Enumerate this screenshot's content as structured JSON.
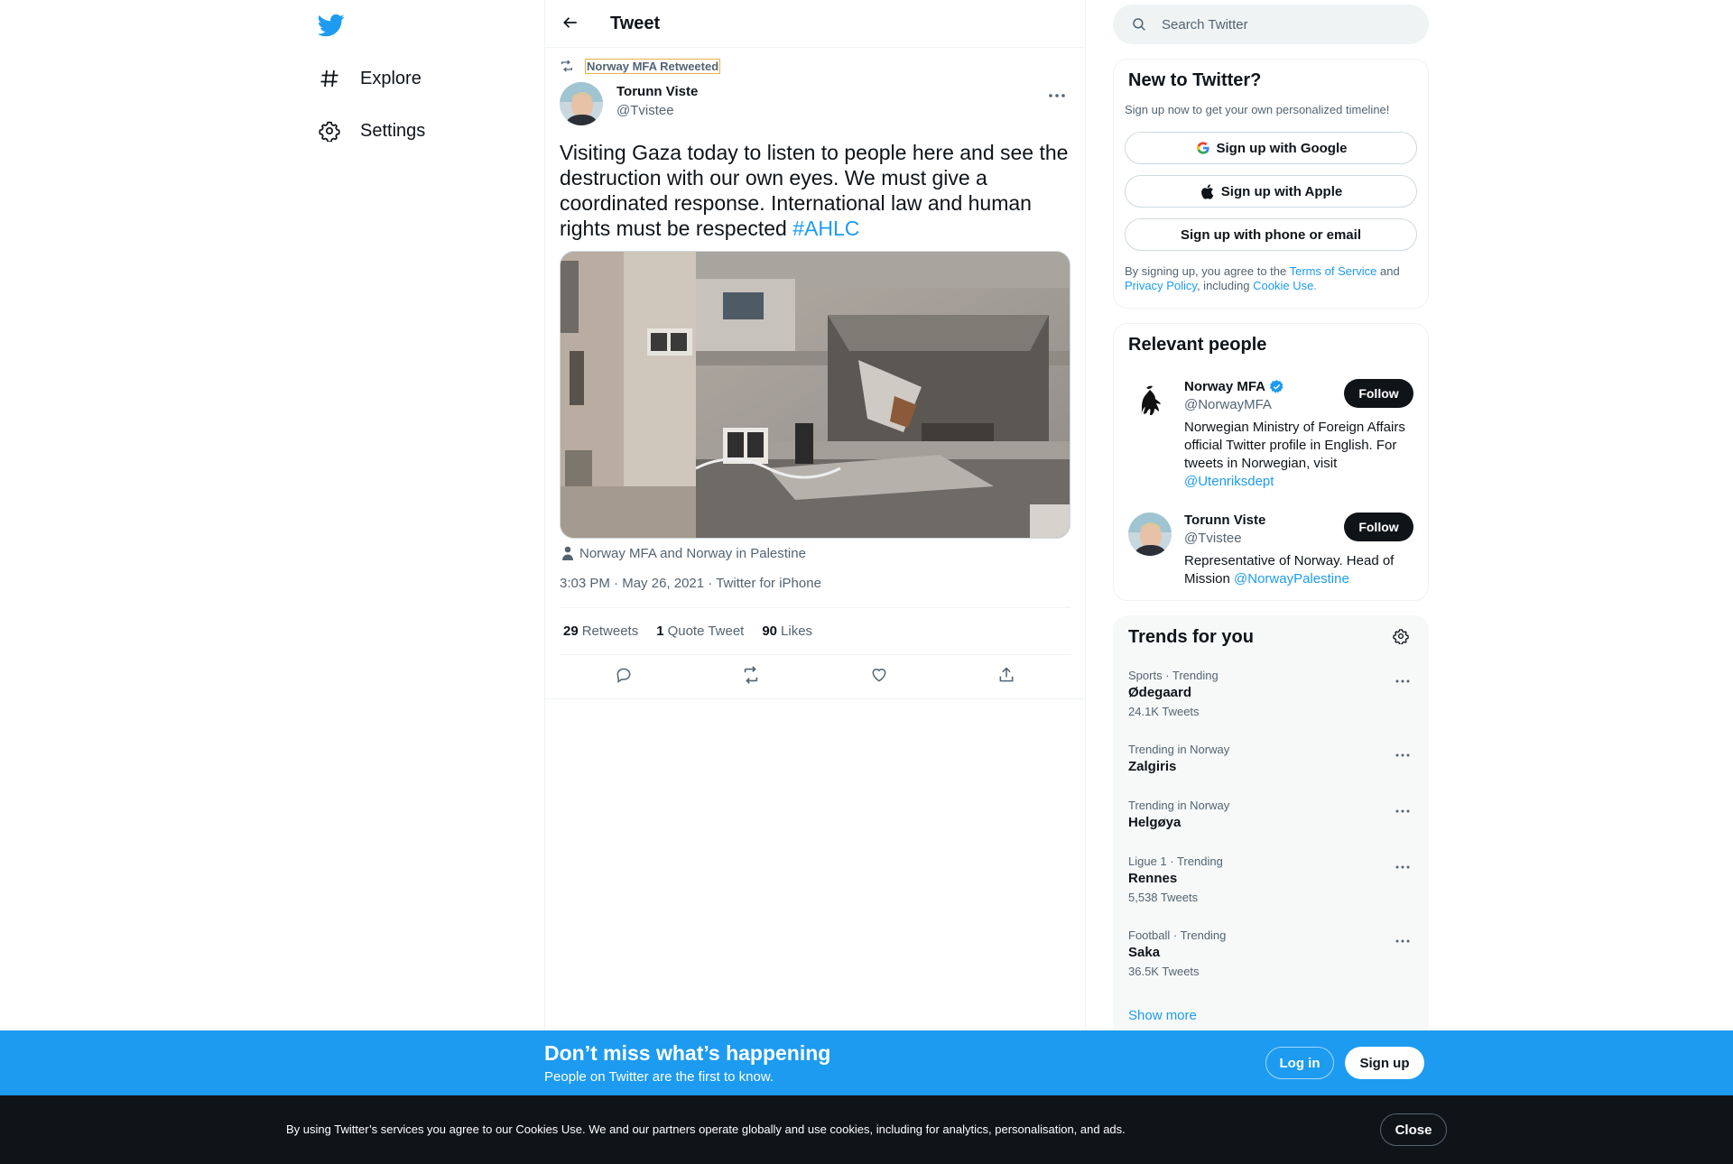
{
  "nav": {
    "logo_icon": "twitter-bird-icon",
    "items": [
      {
        "label": "Explore",
        "icon": "hashtag-icon"
      },
      {
        "label": "Settings",
        "icon": "gear-icon"
      }
    ]
  },
  "header": {
    "title": "Tweet",
    "back_icon": "arrow-left-icon"
  },
  "tweet": {
    "retweeted_by": "Norway MFA Retweeted",
    "author": {
      "name": "Torunn Viste",
      "handle": "@Tvistee"
    },
    "text": "Visiting Gaza today to listen to people here and see the destruction with our own eyes. We must give a coordinated response. International law and human rights must be respected ",
    "hashtag": "#AHLC",
    "tagged": "Norway MFA and Norway in Palestine",
    "time": "3:03 PM",
    "date": "May 26, 2021",
    "source": "Twitter for iPhone",
    "separator": " · ",
    "stats": {
      "retweets": {
        "count": "29",
        "label": "Retweets"
      },
      "quotes": {
        "count": "1",
        "label": "Quote Tweet"
      },
      "likes": {
        "count": "90",
        "label": "Likes"
      }
    }
  },
  "search": {
    "placeholder": "Search Twitter"
  },
  "new_to_twitter": {
    "title": "New to Twitter?",
    "subtitle": "Sign up now to get your own personalized timeline!",
    "buttons": {
      "google": "Sign up with Google",
      "apple": "Sign up with Apple",
      "phone": "Sign up with phone or email"
    },
    "legal": {
      "prefix": "By signing up, you agree to the ",
      "terms": "Terms of Service",
      "and": " and",
      "privacy": "Privacy Policy",
      "including": ", including ",
      "cookie": "Cookie Use."
    }
  },
  "relevant_people": {
    "title": "Relevant people",
    "people": [
      {
        "name": "Norway MFA",
        "handle": "@NorwayMFA",
        "bio": "Norwegian Ministry of Foreign Affairs official Twitter profile in English. For tweets in Norwegian, visit ",
        "bio_link": "@Utenriksdept",
        "follow": "Follow",
        "verified": true
      },
      {
        "name": "Torunn Viste",
        "handle": "@Tvistee",
        "bio": "Representative of Norway. Head of Mission ",
        "bio_link": "@NorwayPalestine",
        "follow": "Follow",
        "verified": false
      }
    ]
  },
  "trends": {
    "title": "Trends for you",
    "items": [
      {
        "context": "Sports · Trending",
        "name": "Ødegaard",
        "count": "24.1K Tweets"
      },
      {
        "context": "Trending in Norway",
        "name": "Zalgiris",
        "count": ""
      },
      {
        "context": "Trending in Norway",
        "name": "Helgøya",
        "count": ""
      },
      {
        "context": "Ligue 1 · Trending",
        "name": "Rennes",
        "count": "5,538 Tweets"
      },
      {
        "context": "Football · Trending",
        "name": "Saka",
        "count": "36.5K Tweets"
      }
    ],
    "show_more": "Show more"
  },
  "promo": {
    "title": "Don’t miss what’s happening",
    "subtitle": "People on Twitter are the first to know.",
    "login": "Log in",
    "signup": "Sign up"
  },
  "cookie_bar": {
    "text": "By using Twitter’s services you agree to our Cookies Use. We and our partners operate globally and use cookies, including for analytics, personalisation, and ads.",
    "close": "Close"
  },
  "colors": {
    "accent": "#1d9bf0",
    "text": "#0f1419",
    "muted": "#536471",
    "cookie_bg": "#0f1419"
  }
}
